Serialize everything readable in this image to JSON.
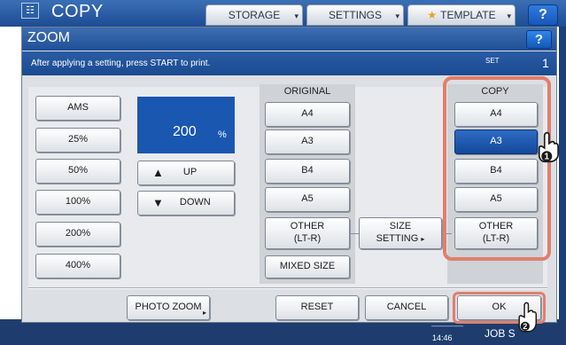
{
  "topbar": {
    "app_icon_text": "☷",
    "title": "COPY",
    "tabs": [
      "STORAGE",
      "SETTINGS",
      "TEMPLATE"
    ],
    "help": "?"
  },
  "dialog": {
    "title": "ZOOM",
    "help": "?",
    "message": "After applying a setting, press START to print.",
    "set_label": "SET",
    "set_value": "1"
  },
  "presets": [
    "AMS",
    "25%",
    "50%",
    "100%",
    "200%",
    "400%"
  ],
  "zoom_display": {
    "value": "200",
    "unit": "%"
  },
  "up_label": "UP",
  "down_label": "DOWN",
  "original": {
    "header": "ORIGINAL",
    "sizes": [
      "A4",
      "A3",
      "B4",
      "A5"
    ],
    "other_line1": "OTHER",
    "other_line2": "(LT-R)",
    "mixed": "MIXED SIZE"
  },
  "size_setting": {
    "line1": "SIZE",
    "line2": "SETTING"
  },
  "copy": {
    "header": "COPY",
    "sizes": [
      "A4",
      "A3",
      "B4",
      "A5"
    ],
    "selected": "A3",
    "other_line1": "OTHER",
    "other_line2": "(LT-R)"
  },
  "bottom_buttons": {
    "photo_zoom": "PHOTO ZOOM",
    "reset": "RESET",
    "cancel": "CANCEL",
    "ok": "OK"
  },
  "statusbar": {
    "time": "14:46",
    "jobs": "JOB S"
  },
  "callouts": [
    "1",
    "2"
  ],
  "colors": {
    "accent_blue": "#1a57b0",
    "highlight": "#e07f6c",
    "title_bar": "#2a5ca5"
  }
}
